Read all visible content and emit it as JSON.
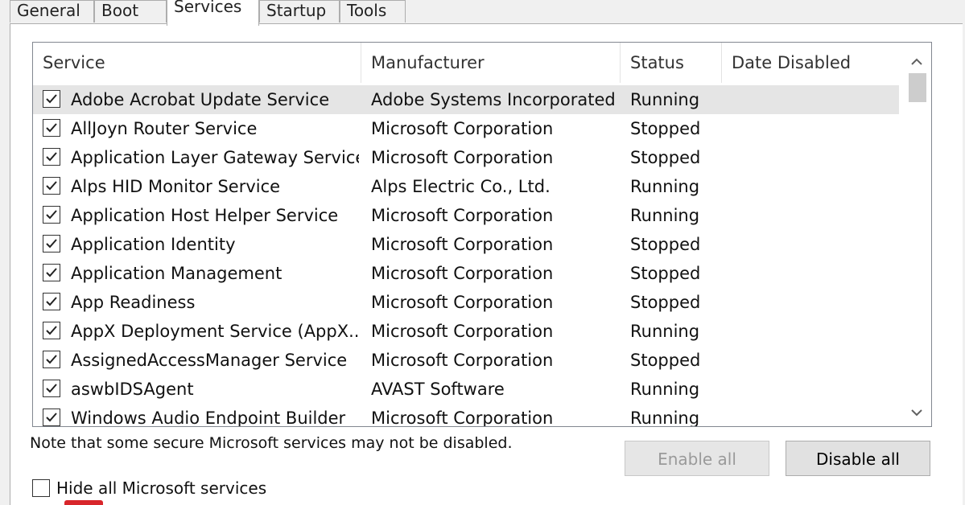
{
  "tabs": [
    {
      "label": "General",
      "active": false
    },
    {
      "label": "Boot",
      "active": false
    },
    {
      "label": "Services",
      "active": true
    },
    {
      "label": "Startup",
      "active": false
    },
    {
      "label": "Tools",
      "active": false
    }
  ],
  "columns": {
    "service": "Service",
    "manufacturer": "Manufacturer",
    "status": "Status",
    "date_disabled": "Date Disabled"
  },
  "rows": [
    {
      "service": "Adobe Acrobat Update Service",
      "manufacturer": "Adobe Systems Incorporated",
      "status": "Running",
      "date_disabled": "",
      "checked": true,
      "selected": true
    },
    {
      "service": "AllJoyn Router Service",
      "manufacturer": "Microsoft Corporation",
      "status": "Stopped",
      "date_disabled": "",
      "checked": true,
      "selected": false
    },
    {
      "service": "Application Layer Gateway Service",
      "manufacturer": "Microsoft Corporation",
      "status": "Stopped",
      "date_disabled": "",
      "checked": true,
      "selected": false
    },
    {
      "service": "Alps HID Monitor Service",
      "manufacturer": "Alps Electric Co., Ltd.",
      "status": "Running",
      "date_disabled": "",
      "checked": true,
      "selected": false
    },
    {
      "service": "Application Host Helper Service",
      "manufacturer": "Microsoft Corporation",
      "status": "Running",
      "date_disabled": "",
      "checked": true,
      "selected": false
    },
    {
      "service": "Application Identity",
      "manufacturer": "Microsoft Corporation",
      "status": "Stopped",
      "date_disabled": "",
      "checked": true,
      "selected": false
    },
    {
      "service": "Application Management",
      "manufacturer": "Microsoft Corporation",
      "status": "Stopped",
      "date_disabled": "",
      "checked": true,
      "selected": false
    },
    {
      "service": "App Readiness",
      "manufacturer": "Microsoft Corporation",
      "status": "Stopped",
      "date_disabled": "",
      "checked": true,
      "selected": false
    },
    {
      "service": "AppX Deployment Service (AppX...",
      "manufacturer": "Microsoft Corporation",
      "status": "Running",
      "date_disabled": "",
      "checked": true,
      "selected": false
    },
    {
      "service": "AssignedAccessManager Service",
      "manufacturer": "Microsoft Corporation",
      "status": "Stopped",
      "date_disabled": "",
      "checked": true,
      "selected": false
    },
    {
      "service": "aswbIDSAgent",
      "manufacturer": "AVAST Software",
      "status": "Running",
      "date_disabled": "",
      "checked": true,
      "selected": false
    },
    {
      "service": "Windows Audio Endpoint Builder",
      "manufacturer": "Microsoft Corporation",
      "status": "Running",
      "date_disabled": "",
      "checked": true,
      "selected": false
    }
  ],
  "scrollbar": {
    "up_icon": "chevron-up-icon",
    "down_icon": "chevron-down-icon"
  },
  "footer": {
    "note": "Note that some secure Microsoft services may not be disabled.",
    "enable_all_label": "Enable all",
    "disable_all_label": "Disable all",
    "hide_ms_label": "Hide all Microsoft services",
    "hide_ms_checked": false
  },
  "colors": {
    "selected_row": "#e5e5e5",
    "window_bg": "#f0f0f0",
    "accent_mark": "#d8262b"
  }
}
